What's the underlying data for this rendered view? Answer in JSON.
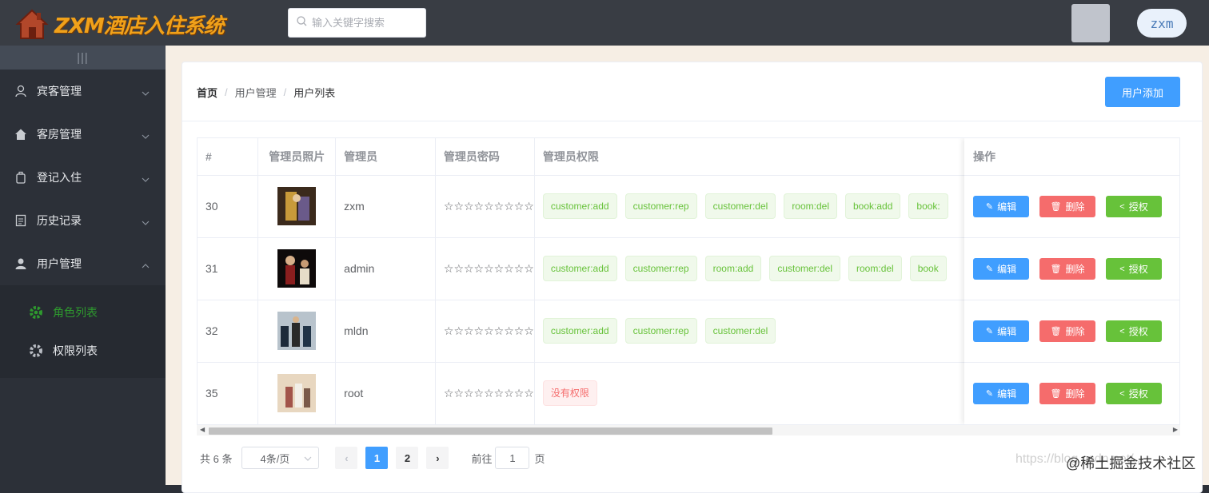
{
  "app": {
    "title": "ZXM酒店入住系统"
  },
  "search": {
    "placeholder": "输入关键字搜索"
  },
  "user": {
    "name": "zxm"
  },
  "sidebar": {
    "collapse_icon": "|||",
    "items": [
      {
        "label": "宾客管理",
        "icon": "user-icon"
      },
      {
        "label": "客房管理",
        "icon": "home-icon"
      },
      {
        "label": "登记入住",
        "icon": "suitcase-icon"
      },
      {
        "label": "历史记录",
        "icon": "document-icon"
      },
      {
        "label": "用户管理",
        "icon": "person-icon"
      }
    ],
    "subitems": [
      {
        "label": "角色列表",
        "icon": "gear-icon",
        "active": true
      },
      {
        "label": "权限列表",
        "icon": "gear-icon",
        "active": false
      }
    ]
  },
  "breadcrumb": {
    "home": "首页",
    "level1": "用户管理",
    "level2": "用户列表",
    "separator": "/"
  },
  "add_button": {
    "label": "用户添加"
  },
  "table": {
    "headers": [
      "#",
      "管理员照片",
      "管理员",
      "管理员密码",
      "管理员权限",
      "操作"
    ],
    "rows": [
      {
        "id": "30",
        "name": "zxm",
        "password": "☆☆☆☆☆☆☆☆☆",
        "perms": [
          "customer:add",
          "customer:rep",
          "customer:del",
          "room:del",
          "book:add",
          "book:"
        ]
      },
      {
        "id": "31",
        "name": "admin",
        "password": "☆☆☆☆☆☆☆☆☆",
        "perms": [
          "customer:add",
          "customer:rep",
          "room:add",
          "customer:del",
          "room:del",
          "book"
        ]
      },
      {
        "id": "32",
        "name": "mldn",
        "password": "☆☆☆☆☆☆☆☆☆",
        "perms": [
          "customer:add",
          "customer:rep",
          "customer:del"
        ]
      },
      {
        "id": "35",
        "name": "root",
        "password": "☆☆☆☆☆☆☆☆☆",
        "perms": [],
        "no_perm": "没有权限"
      }
    ],
    "ops": {
      "edit": "编辑",
      "delete": "删除",
      "grant": "授权"
    }
  },
  "pagination": {
    "total": "共 6 条",
    "page_size": "4条/页",
    "pages": [
      "1",
      "2"
    ],
    "current": "1",
    "goto_prefix": "前往",
    "goto_value": "1",
    "goto_suffix": "页"
  },
  "watermark": {
    "faint": "https://blog.csdn.net/...",
    "strong": "@稀土掘金技术社区"
  }
}
